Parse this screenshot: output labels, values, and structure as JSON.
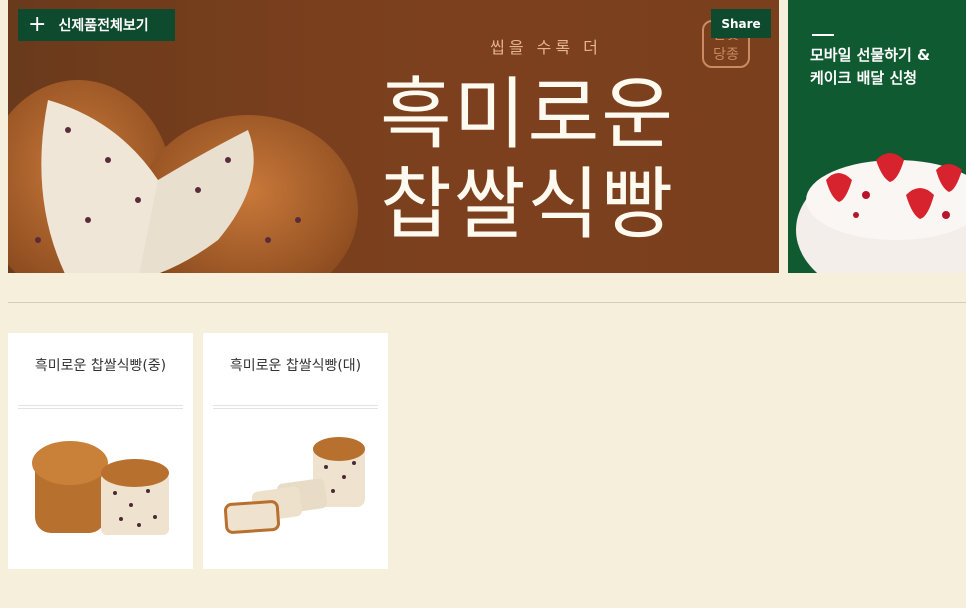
{
  "hero": {
    "all_button": "신제품전체보기",
    "share_button": "Share",
    "subtitle": "씹을 수록 더",
    "title_line1": "흑미로운",
    "title_line2": "찹쌀식빵",
    "seal_line1": "달빛",
    "seal_line2": "당종"
  },
  "side_banner": {
    "line1": "모바일 선물하기 &",
    "line2": "케이크 배달 신청"
  },
  "products": [
    {
      "name": "흑미로운 찹쌀식빵(중)"
    },
    {
      "name": "흑미로운 찹쌀식빵(대)"
    }
  ]
}
